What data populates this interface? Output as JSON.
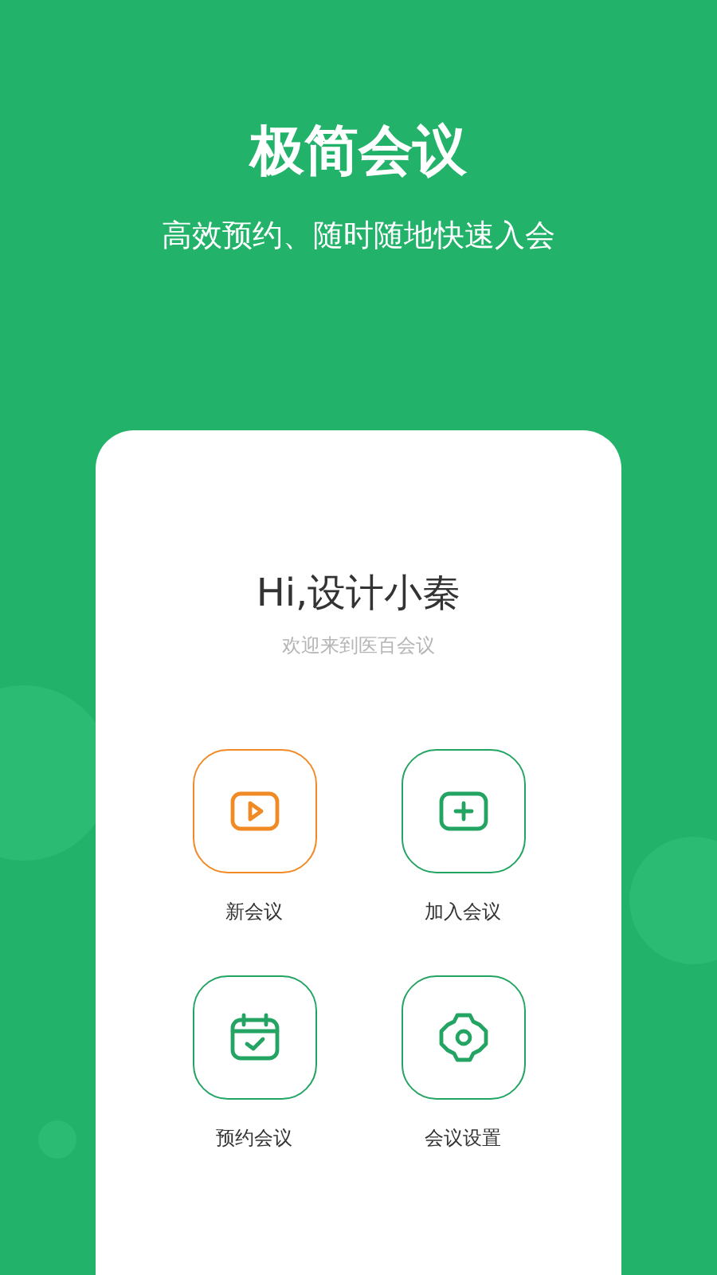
{
  "header": {
    "title": "极简会议",
    "subtitle": "高效预约、随时随地快速入会"
  },
  "card": {
    "greeting": "Hi,设计小秦",
    "welcome": "欢迎来到医百会议",
    "actions": [
      {
        "kind": "new",
        "label": "新会议",
        "color": "#f08a24"
      },
      {
        "kind": "join",
        "label": "加入会议",
        "color": "#23a463"
      },
      {
        "kind": "schedule",
        "label": "预约会议",
        "color": "#23a463"
      },
      {
        "kind": "settings",
        "label": "会议设置",
        "color": "#23a463"
      }
    ]
  }
}
